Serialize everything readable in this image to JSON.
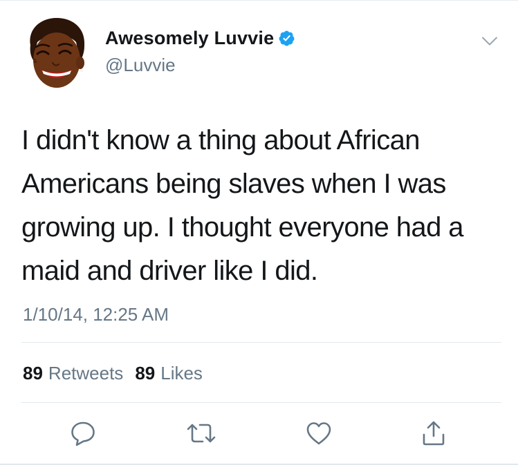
{
  "author": {
    "display_name": "Awesomely Luvvie",
    "handle": "@Luvvie",
    "verified": true,
    "avatar_icon": "cartoon-avatar"
  },
  "tweet": {
    "lines": [
      "I didn't know a thing about African",
      "Americans being slaves when I was",
      "growing up. I thought everyone had a",
      "maid and driver like I did."
    ],
    "timestamp": "1/10/14, 12:25 AM"
  },
  "stats": {
    "retweets_count": "89",
    "retweets_label": "Retweets",
    "likes_count": "89",
    "likes_label": "Likes"
  },
  "actions": {
    "reply_icon": "reply-icon",
    "retweet_icon": "retweet-icon",
    "like_icon": "heart-icon",
    "share_icon": "share-icon"
  },
  "colors": {
    "text": "#14171a",
    "secondary_text": "#657786",
    "verified_blue": "#1da1f2",
    "divider": "#e1e8ed",
    "icon_gray": "#657786"
  }
}
